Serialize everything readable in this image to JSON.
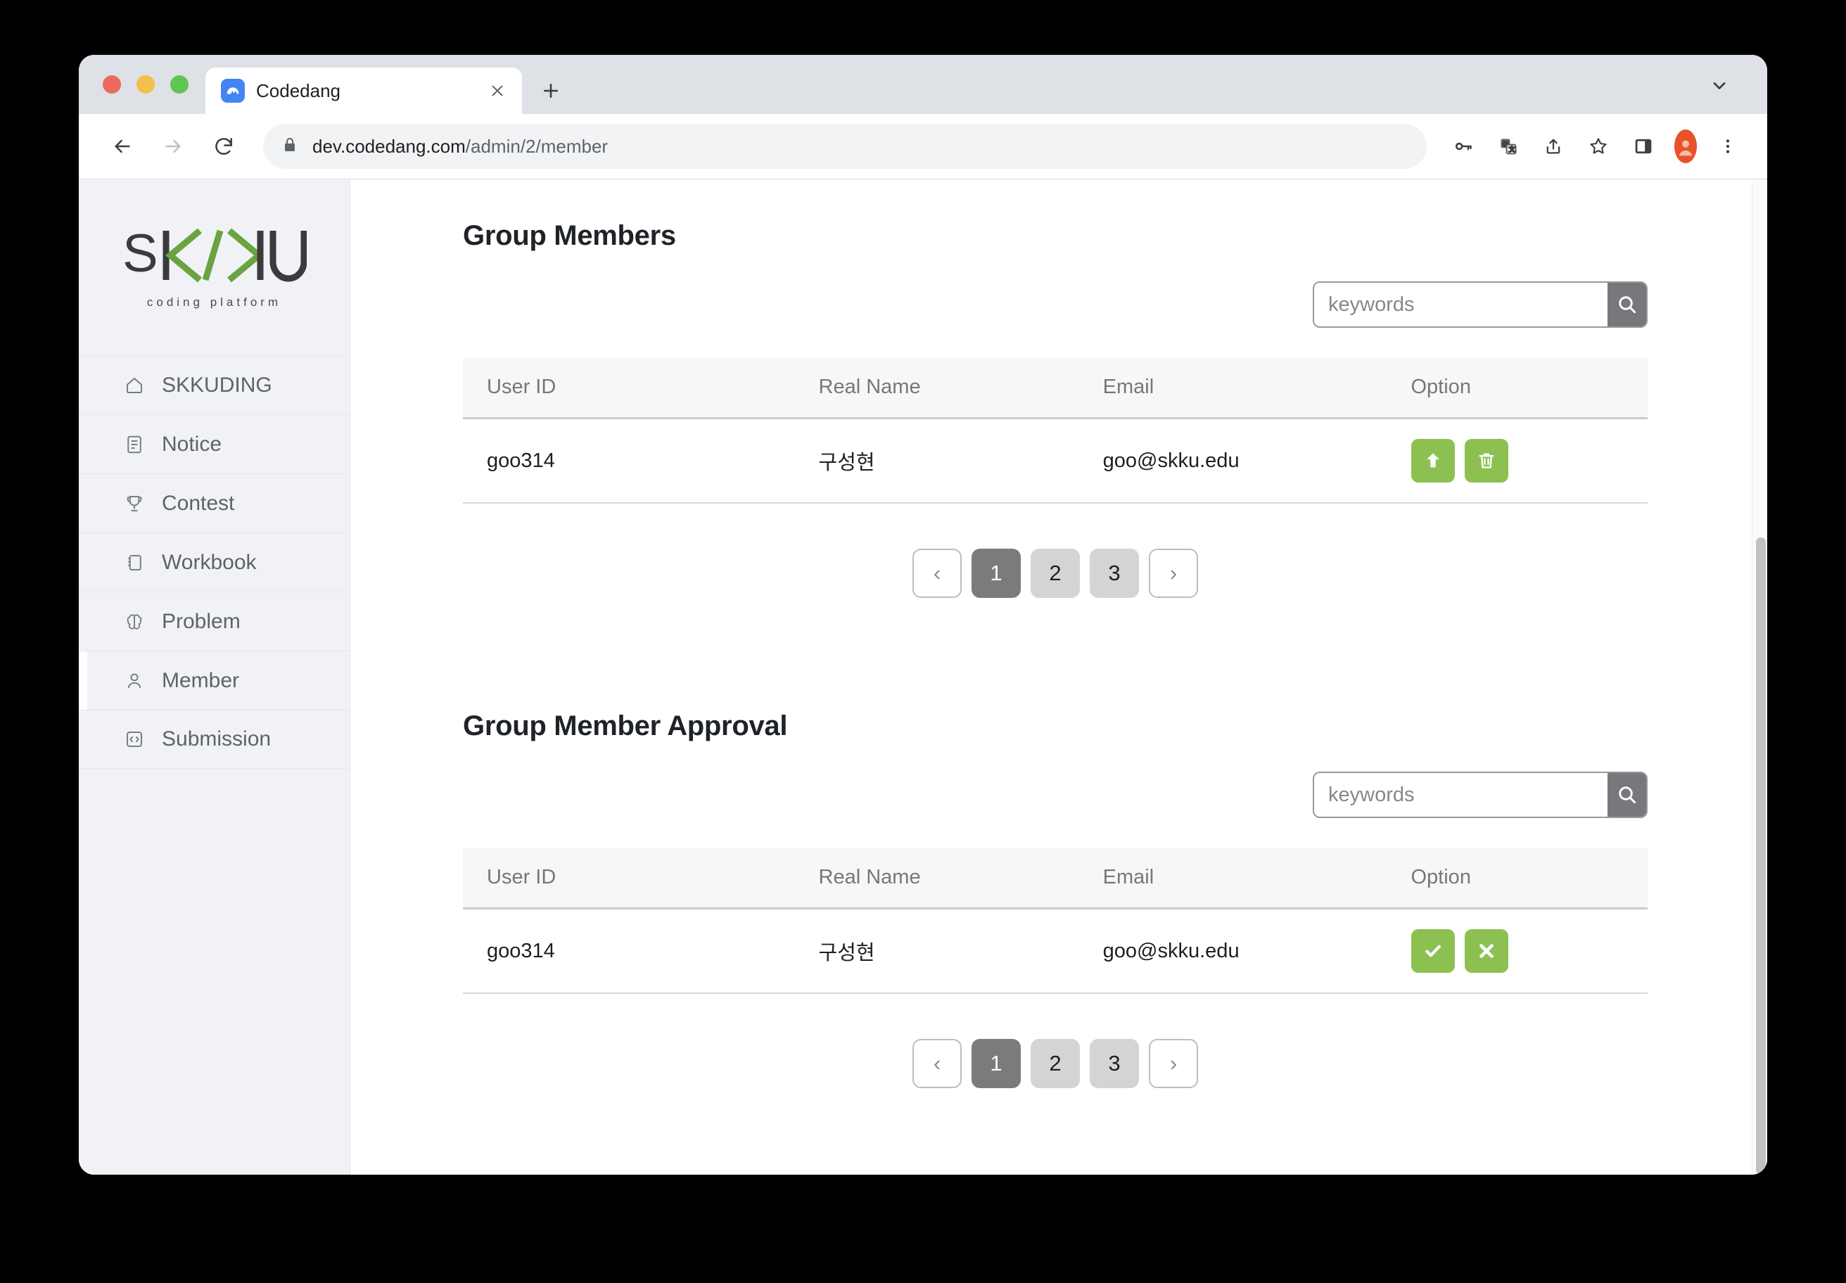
{
  "browser": {
    "tab": {
      "title": "Codedang",
      "favicon": "codedang-favicon",
      "close": "×"
    },
    "new_tab_label": "+",
    "tab_list_label": "⌄",
    "url_domain": "dev.codedang.com",
    "url_path": "/admin/2/member",
    "nav": {
      "back": "←",
      "forward": "→",
      "reload": "⟳"
    },
    "toolbar_icons": [
      "key-icon",
      "translate-icon",
      "share-icon",
      "bookmark-star-icon",
      "side-panel-icon",
      "profile-avatar",
      "chrome-menu-icon"
    ]
  },
  "sidebar": {
    "logo": {
      "text": "SK/KU",
      "subtitle": "coding platform",
      "accent": "#6aa341"
    },
    "items": [
      {
        "label": "SKKUDING",
        "icon": "home-icon",
        "active": false
      },
      {
        "label": "Notice",
        "icon": "document-icon",
        "active": false
      },
      {
        "label": "Contest",
        "icon": "trophy-icon",
        "active": false
      },
      {
        "label": "Workbook",
        "icon": "book-icon",
        "active": false
      },
      {
        "label": "Problem",
        "icon": "brain-icon",
        "active": false
      },
      {
        "label": "Member",
        "icon": "person-icon",
        "active": true
      },
      {
        "label": "Submission",
        "icon": "code-brackets-icon",
        "active": false
      }
    ]
  },
  "sections": [
    {
      "title": "Group Members",
      "search": {
        "value": "",
        "placeholder": "keywords",
        "button_icon": "search-icon"
      },
      "columns": [
        "User ID",
        "Real Name",
        "Email",
        "Option"
      ],
      "rows": [
        {
          "user_id": "goo314",
          "real_name": "구성현",
          "email": "goo@skku.edu",
          "actions": [
            {
              "name": "promote-button",
              "icon": "arrow-up-icon",
              "color": "#8cc152"
            },
            {
              "name": "delete-button",
              "icon": "trash-icon",
              "color": "#8cc152"
            }
          ]
        }
      ],
      "pagination": {
        "prev": "‹",
        "next": "›",
        "pages": [
          "1",
          "2",
          "3"
        ],
        "current": "1"
      }
    },
    {
      "title": "Group Member Approval",
      "search": {
        "value": "",
        "placeholder": "keywords",
        "button_icon": "search-icon"
      },
      "columns": [
        "User ID",
        "Real Name",
        "Email",
        "Option"
      ],
      "rows": [
        {
          "user_id": "goo314",
          "real_name": "구성현",
          "email": "goo@skku.edu",
          "actions": [
            {
              "name": "approve-button",
              "icon": "check-icon",
              "color": "#8cc152"
            },
            {
              "name": "reject-button",
              "icon": "close-x-icon",
              "color": "#8cc152"
            }
          ]
        }
      ],
      "pagination": {
        "prev": "‹",
        "next": "›",
        "pages": [
          "1",
          "2",
          "3"
        ],
        "current": "1"
      }
    }
  ],
  "colors": {
    "accent_green": "#8cc152",
    "logo_green": "#6aa341",
    "active_page": "#7b7b7b",
    "sidebar_bg": "#f1f2f5"
  }
}
